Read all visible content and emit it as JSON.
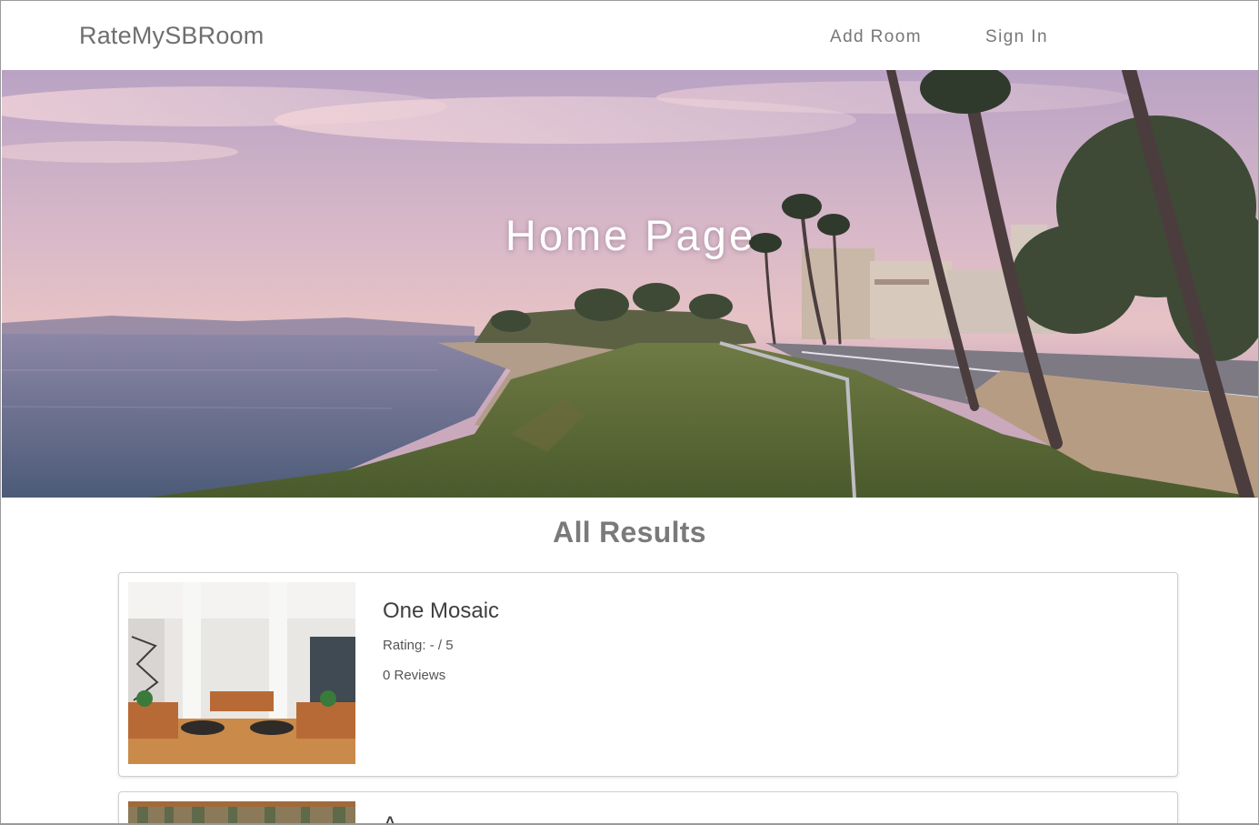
{
  "navbar": {
    "brand": "RateMySBRoom",
    "links": [
      {
        "label": "Add Room"
      },
      {
        "label": "Sign In"
      }
    ]
  },
  "hero": {
    "title": "Home Page"
  },
  "results": {
    "heading": "All Results",
    "items": [
      {
        "name": "One Mosaic",
        "rating_text": "Rating: - / 5",
        "reviews_text": "0 Reviews"
      },
      {
        "name": "A"
      }
    ]
  },
  "colors": {
    "background": "#ffffff",
    "brand_text": "#6f6f6f",
    "hero_title": "#ffffff",
    "card_border": "#cfcfcf"
  },
  "icons": []
}
